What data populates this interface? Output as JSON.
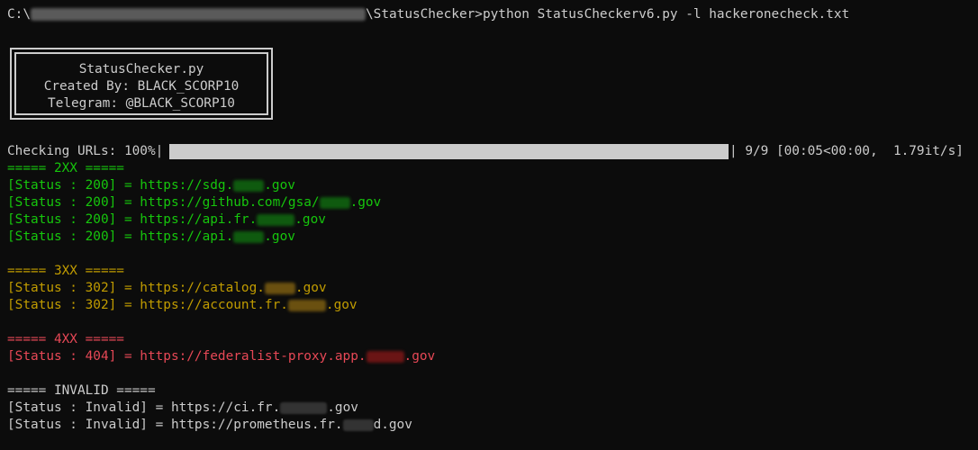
{
  "command": {
    "prefix": "C:\\",
    "path_suffix": "\\StatusChecker>",
    "text": "python StatusCheckerv6.py -l hackeronecheck.txt"
  },
  "banner": {
    "line1": "StatusChecker.py",
    "line2": "Created By: BLACK_SCORP10",
    "line3": "Telegram: @BLACK_SCORP10"
  },
  "progress": {
    "label": "Checking URLs: 100%|",
    "fraction": 1.0,
    "stats": "| 9/9 [00:05<00:00,  1.79it/s]"
  },
  "groups": {
    "2xx": {
      "header": "===== 2XX =====",
      "rows": [
        {
          "status": "[Status : 200] = https://sdg.",
          "tld": ".gov"
        },
        {
          "status": "[Status : 200] = https://github.com/gsa/",
          "tld": ".gov"
        },
        {
          "status": "[Status : 200] = https://api.fr.",
          "tld": ".gov"
        },
        {
          "status": "[Status : 200] = https://api.",
          "tld": ".gov"
        }
      ]
    },
    "3xx": {
      "header": "===== 3XX =====",
      "rows": [
        {
          "status": "[Status : 302] = https://catalog.",
          "tld": ".gov"
        },
        {
          "status": "[Status : 302] = https://account.fr.",
          "tld": ".gov"
        }
      ]
    },
    "4xx": {
      "header": "===== 4XX =====",
      "rows": [
        {
          "status": "[Status : 404] = https://federalist-proxy.app.",
          "tld": ".gov"
        }
      ]
    },
    "invalid": {
      "header": "===== INVALID =====",
      "rows": [
        {
          "status": "[Status : Invalid] = https://ci.fr.",
          "tld": ".gov"
        },
        {
          "status": "[Status : Invalid] = https://prometheus.fr.",
          "tld": "d.gov"
        }
      ]
    }
  },
  "colors": {
    "background": "#0c0c0c",
    "text": "#cccccc",
    "ok": "#16c60c",
    "redirect": "#c19c00",
    "error": "#e74856"
  }
}
